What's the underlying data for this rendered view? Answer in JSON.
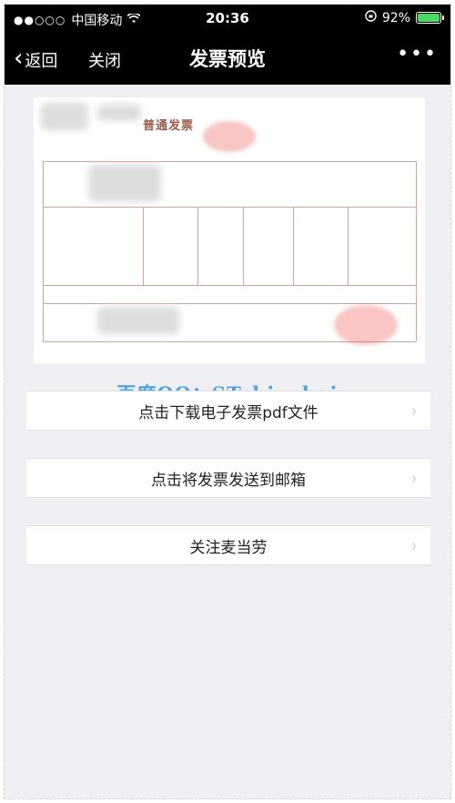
{
  "status_bar": {
    "carrier": "中国移动",
    "time": "20:36",
    "battery_percent": "92%",
    "battery_level": 0.92,
    "battery_color": "#4cd964"
  },
  "nav": {
    "back_label": "返回",
    "close_label": "关闭",
    "title": "发票预览",
    "more_label": "•••"
  },
  "invoice_preview": {
    "title_text": "普通发票",
    "stamp_color": "#f05a5a"
  },
  "watermark": "百度QQ：STchiyuhai",
  "actions": [
    {
      "label": "点击下载电子发票pdf文件",
      "icon": "chevron-right-icon"
    },
    {
      "label": "点击将发票发送到邮箱",
      "icon": "chevron-right-icon"
    },
    {
      "label": "关注麦当劳",
      "icon": "chevron-right-icon"
    }
  ]
}
